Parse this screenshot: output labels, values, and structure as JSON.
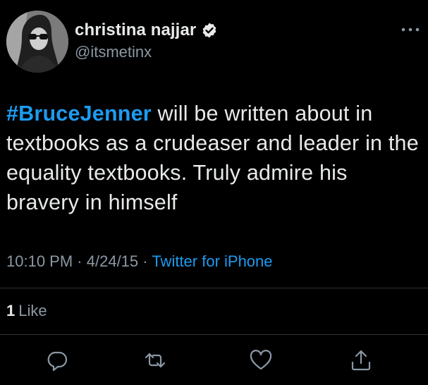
{
  "author": {
    "display_name": "christina najjar",
    "handle": "@itsmetinx",
    "verified_icon": "verified-badge-icon",
    "avatar_icon": "profile-photo"
  },
  "tweet": {
    "hashtag": "#BruceJenner",
    "text": " will be written about in textbooks as a crudeaser and leader in the equality textbooks. Truly admire his bravery in himself"
  },
  "meta": {
    "time": "10:10 PM",
    "separator": "·",
    "date": "4/24/15",
    "source": "Twitter for iPhone"
  },
  "stats": {
    "like_count": "1",
    "like_label": "Like"
  },
  "actions": [
    "reply-icon",
    "retweet-icon",
    "like-icon",
    "share-icon"
  ],
  "colors": {
    "background": "#000000",
    "text": "#e7e9ea",
    "secondary": "#8b98a5",
    "link": "#1d9bf0",
    "divider": "#2f3336"
  }
}
